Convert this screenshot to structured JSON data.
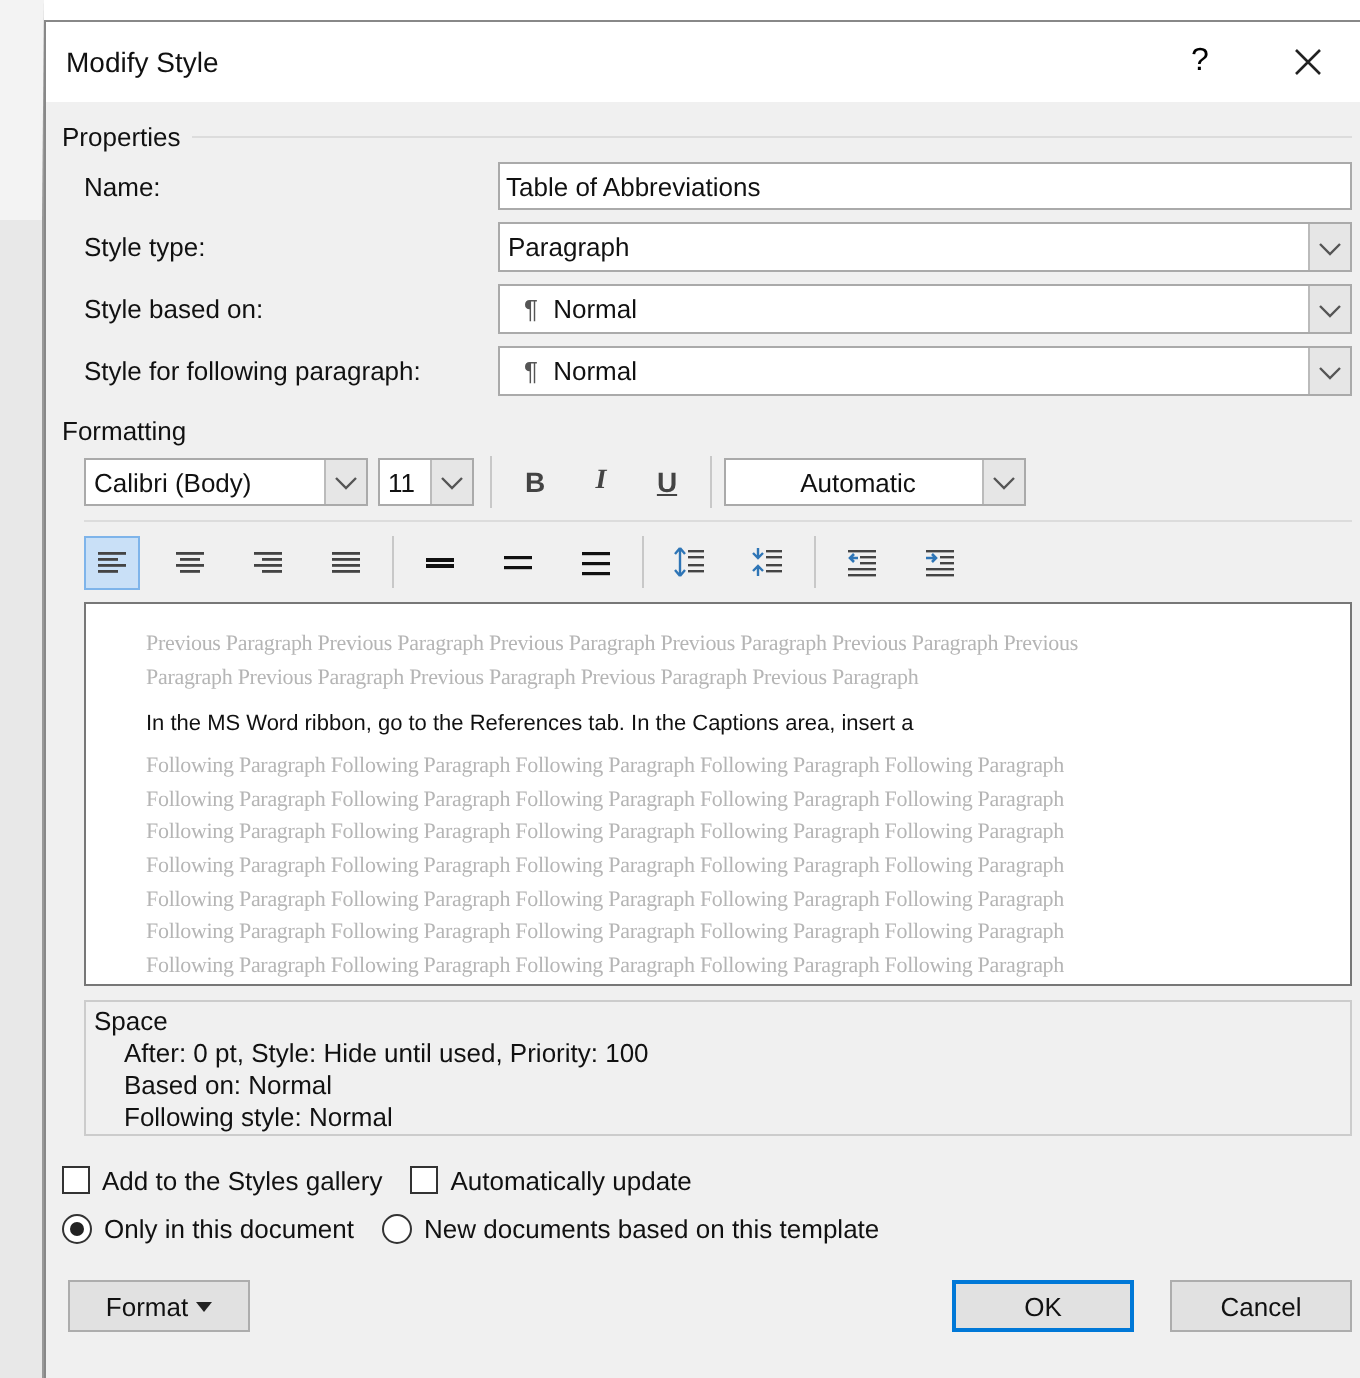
{
  "window": {
    "title": "Modify Style",
    "help": "?"
  },
  "properties": {
    "heading": "Properties",
    "fields": [
      {
        "kind": "text",
        "label": "Name:",
        "value": "Table of Abbreviations"
      },
      {
        "kind": "dropdown",
        "label": "Style type:",
        "value": "Paragraph"
      },
      {
        "kind": "style-dropdown",
        "label": "Style based on:",
        "mark": "¶",
        "value": "Normal"
      },
      {
        "kind": "style-dropdown",
        "label": "Style for following paragraph:",
        "mark": "¶",
        "value": "Normal"
      }
    ]
  },
  "formatting": {
    "heading": "Formatting",
    "font": "Calibri (Body)",
    "size": "11",
    "styles": [
      {
        "kind": "bold",
        "label": "B"
      },
      {
        "kind": "italic",
        "label": "I"
      },
      {
        "kind": "underline",
        "label": "U"
      }
    ],
    "font_color": "Automatic",
    "paragraph_groups": [
      {
        "buttons": [
          {
            "kind": "align-left",
            "selected": true
          },
          {
            "kind": "align-center",
            "selected": false
          },
          {
            "kind": "align-right",
            "selected": false
          },
          {
            "kind": "justify",
            "selected": false
          }
        ]
      },
      {
        "buttons": [
          {
            "kind": "single-spacing",
            "selected": false
          },
          {
            "kind": "one-half-spacing",
            "selected": false
          },
          {
            "kind": "double-spacing",
            "selected": false
          }
        ]
      },
      {
        "buttons": [
          {
            "kind": "increase-spacing",
            "selected": false
          },
          {
            "kind": "decrease-spacing",
            "selected": false
          }
        ]
      },
      {
        "buttons": [
          {
            "kind": "decrease-indent",
            "selected": false
          },
          {
            "kind": "increase-indent",
            "selected": false
          }
        ]
      }
    ]
  },
  "preview": {
    "previous_lines": [
      "Previous Paragraph Previous Paragraph Previous Paragraph Previous Paragraph Previous Paragraph Previous",
      "Paragraph Previous Paragraph Previous Paragraph Previous Paragraph Previous Paragraph"
    ],
    "sample": "In the MS Word ribbon, go to the References tab.  In the Captions area, insert a",
    "following_lines": [
      "Following Paragraph Following Paragraph Following Paragraph Following Paragraph Following Paragraph",
      "Following Paragraph Following Paragraph Following Paragraph Following Paragraph Following Paragraph",
      "Following Paragraph Following Paragraph Following Paragraph Following Paragraph Following Paragraph",
      "Following Paragraph Following Paragraph Following Paragraph Following Paragraph Following Paragraph",
      "Following Paragraph Following Paragraph Following Paragraph Following Paragraph Following Paragraph",
      "Following Paragraph Following Paragraph Following Paragraph Following Paragraph Following Paragraph",
      "Following Paragraph Following Paragraph Following Paragraph Following Paragraph Following Paragraph"
    ]
  },
  "description": {
    "title": "Space",
    "lines": [
      "After:  0 pt, Style: Hide until used, Priority: 100",
      "Based on: Normal",
      "Following style: Normal"
    ]
  },
  "options": {
    "checkboxes": [
      {
        "label": "Add to the Styles gallery",
        "checked": false
      },
      {
        "label": "Automatically update",
        "checked": false
      }
    ],
    "radios": [
      {
        "label": "Only in this document",
        "selected": true
      },
      {
        "label": "New documents based on this template",
        "selected": false
      }
    ]
  },
  "buttons": [
    {
      "kind": "menu",
      "label": "Format"
    },
    {
      "kind": "default",
      "label": "OK"
    },
    {
      "kind": "normal",
      "label": "Cancel"
    }
  ]
}
